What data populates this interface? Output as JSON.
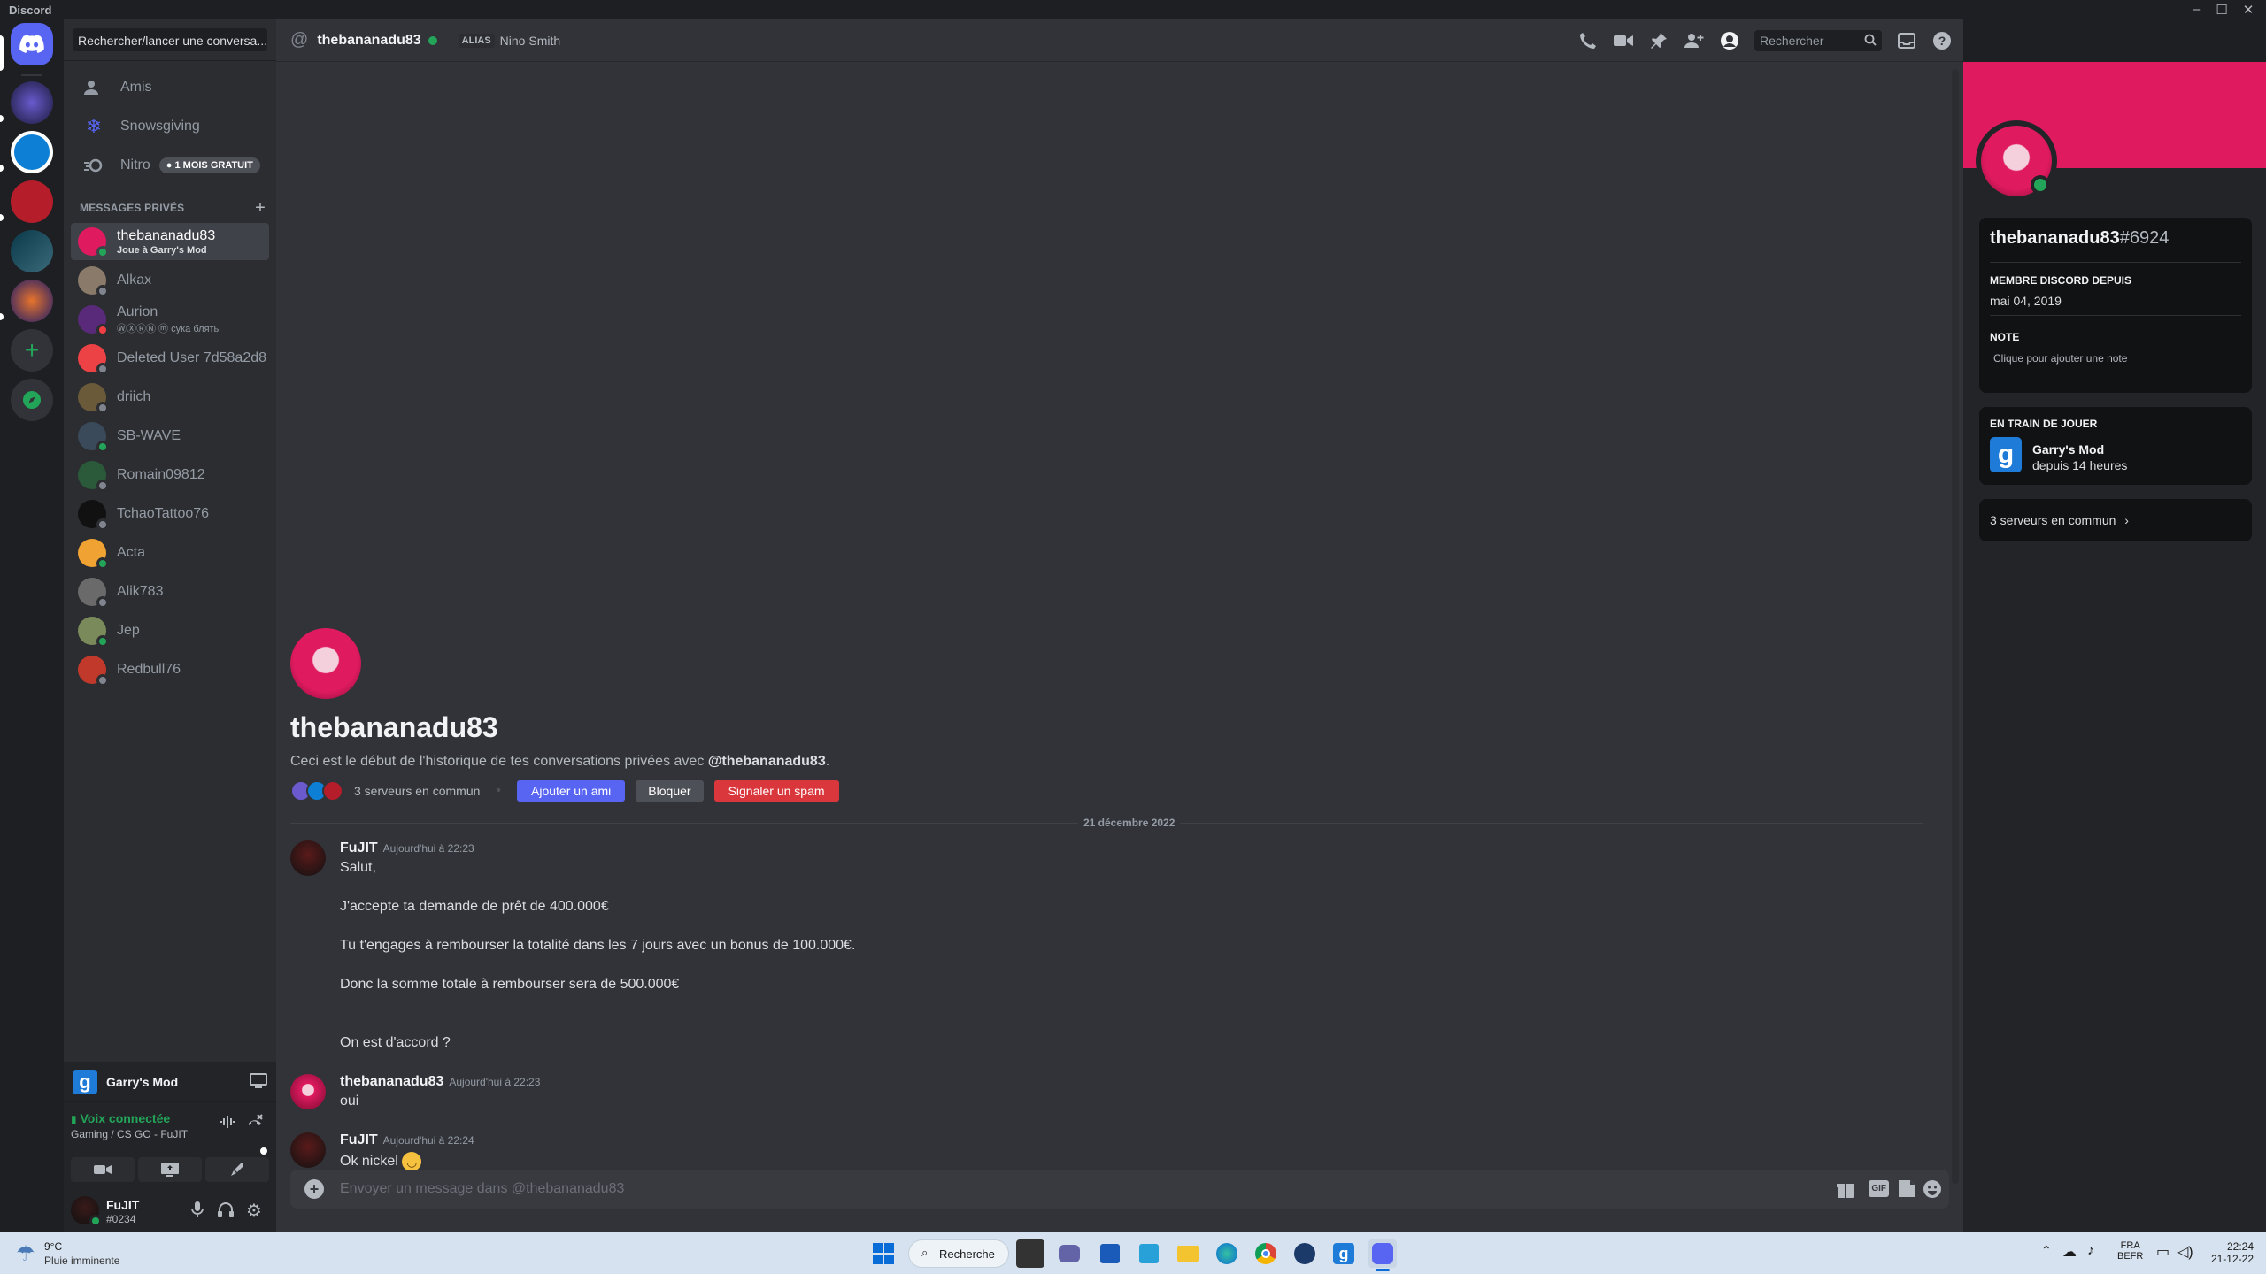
{
  "window": {
    "title": "Discord"
  },
  "sidebar": {
    "search_label": "Rechercher/lancer une conversa...",
    "nav": [
      {
        "label": "Amis",
        "icon": "friends-icon"
      },
      {
        "label": "Snowsgiving",
        "icon": "snowflake-icon"
      },
      {
        "label": "Nitro",
        "icon": "nitro-icon",
        "badge": "1 MOIS GRATUIT"
      }
    ],
    "dm_header": "MESSAGES PRIVÉS",
    "dms": [
      {
        "name": "thebananadu83",
        "sub": "Joue à Garry's Mod",
        "active": true,
        "status": "online",
        "color": "#e01a5f"
      },
      {
        "name": "Alkax",
        "sub": "",
        "status": "offline",
        "color": "#8a7a6a"
      },
      {
        "name": "Aurion",
        "sub": "ⓌⓍⓇⓃ ⓜ сука блять",
        "status": "dnd",
        "color": "#5a2a7a"
      },
      {
        "name": "Deleted User 7d58a2d8",
        "sub": "",
        "status": "offline",
        "color": "#ed4245"
      },
      {
        "name": "driich",
        "sub": "",
        "status": "offline",
        "color": "#6a5a3a"
      },
      {
        "name": "SB-WAVE",
        "sub": "",
        "status": "online",
        "color": "#3a4a5a"
      },
      {
        "name": "Romain09812",
        "sub": "",
        "status": "offline",
        "color": "#2a5a3a"
      },
      {
        "name": "TchaoTattoo76",
        "sub": "",
        "status": "offline",
        "color": "#111111"
      },
      {
        "name": "Acta",
        "sub": "",
        "status": "online",
        "color": "#f0a232"
      },
      {
        "name": "Alik783",
        "sub": "",
        "status": "offline",
        "color": "#6a6a6a"
      },
      {
        "name": "Jep",
        "sub": "",
        "status": "online",
        "color": "#7a8a5a"
      },
      {
        "name": "Redbull76",
        "sub": "",
        "status": "offline",
        "color": "#c0392b"
      }
    ],
    "activity": {
      "game": "Garry's Mod"
    },
    "voice": {
      "status": "Voix connectée",
      "channel": "Gaming / CS GO - FuJIT"
    },
    "user": {
      "name": "FuJIT",
      "tag": "#0234"
    }
  },
  "header": {
    "name": "thebananadu83",
    "alias_label": "ALIAS",
    "alias": "Nino Smith",
    "search_placeholder": "Rechercher"
  },
  "intro": {
    "name": "thebananadu83",
    "text_prefix": "Ceci est le début de l'historique de tes conversations privées avec ",
    "mention": "@thebananadu83",
    "text_suffix": ".",
    "mutual": "3 serveurs en commun",
    "add_friend": "Ajouter un ami",
    "block": "Bloquer",
    "report": "Signaler un spam"
  },
  "date_divider": "21 décembre 2022",
  "messages": [
    {
      "author": "FuJIT",
      "time": "Aujourd'hui à 22:23",
      "lines": [
        "Salut,",
        "J'accepte ta demande de prêt de 400.000€",
        "Tu t'engages à rembourser la totalité dans les 7 jours avec un bonus de 100.000€.",
        "Donc la somme totale à rembourser sera de 500.000€",
        "On est d'accord ?"
      ]
    },
    {
      "author": "thebananadu83",
      "time": "Aujourd'hui à 22:23",
      "lines": [
        "oui"
      ]
    },
    {
      "author": "FuJIT",
      "time": "Aujourd'hui à 22:24",
      "lines": [
        "Ok nickel"
      ]
    }
  ],
  "composer": {
    "placeholder": "Envoyer un message dans @thebananadu83"
  },
  "profile": {
    "name": "thebananadu83",
    "discriminator": "#6924",
    "member_since_label": "MEMBRE DISCORD DEPUIS",
    "member_since": "mai 04, 2019",
    "note_label": "NOTE",
    "note_placeholder": "Clique pour ajouter une note",
    "playing_label": "EN TRAIN DE JOUER",
    "game": "Garry's Mod",
    "game_time": "depuis 14 heures",
    "mutual_servers": "3 serveurs en commun"
  },
  "taskbar": {
    "weather_temp": "9°C",
    "weather_desc": "Pluie imminente",
    "search": "Recherche",
    "lang1": "FRA",
    "lang2": "BEFR",
    "time": "22:24",
    "date": "21-12-22"
  },
  "colors": {
    "blurple": "#5865f2",
    "danger": "#da373c",
    "online": "#23a559",
    "banner": "#e01a5f"
  }
}
